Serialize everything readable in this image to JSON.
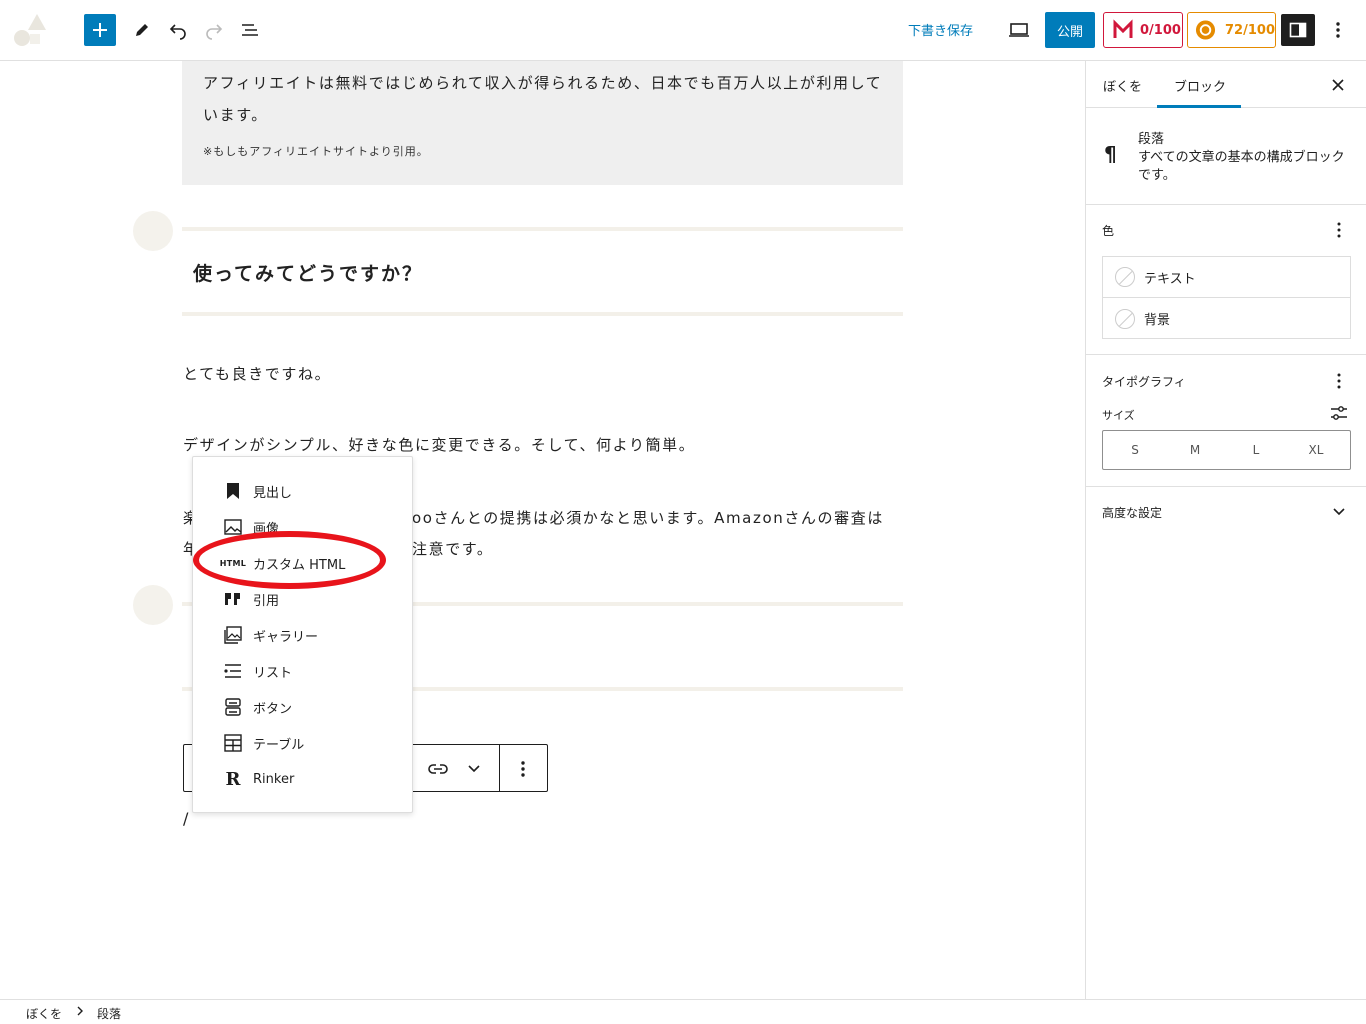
{
  "toolbar": {
    "save_draft": "下書き保存",
    "publish": "公開",
    "seo_score": "0/100",
    "readability_score": "72/100"
  },
  "content": {
    "quote_text": "アフィリエイトは無料ではじめられて収入が得られるため、日本でも百万人以上が利用しています。",
    "quote_cite": "※もしもアフィリエイトサイトより引用。",
    "heading": "使ってみてどうですか？",
    "para1": "とても良きですね。",
    "para2": "デザインがシンプル、好きな色に変更できる。そして、何より簡単。",
    "para3_left": "楽",
    "para3_right": "ooさんとの提携は必須かなと思います。Amazonさんの審査は",
    "para4_left": "年",
    "para4_right": "注意です。",
    "slash": "/"
  },
  "inserter": {
    "items": [
      {
        "label": "見出し",
        "icon": "bookmark-icon"
      },
      {
        "label": "画像",
        "icon": "image-icon"
      },
      {
        "label": "カスタム HTML",
        "icon": "html-icon"
      },
      {
        "label": "引用",
        "icon": "quote-icon"
      },
      {
        "label": "ギャラリー",
        "icon": "gallery-icon"
      },
      {
        "label": "リスト",
        "icon": "list-icon"
      },
      {
        "label": "ボタン",
        "icon": "buttons-icon"
      },
      {
        "label": "テーブル",
        "icon": "table-icon"
      },
      {
        "label": "Rinker",
        "icon": "rinker-icon"
      }
    ],
    "html_icon_text": "HTML",
    "rinker_icon_text": "R"
  },
  "sidebar": {
    "tab_post": "ぼくを",
    "tab_block": "ブロック",
    "block_name": "段落",
    "block_desc": "すべての文章の基本の構成ブロックです。",
    "color_title": "色",
    "color_text": "テキスト",
    "color_bg": "背景",
    "typography_title": "タイポグラフィ",
    "size_label": "サイズ",
    "sizes": [
      "S",
      "M",
      "L",
      "XL"
    ],
    "advanced_title": "高度な設定"
  },
  "breadcrumb": {
    "root": "ぼくを",
    "current": "段落"
  },
  "colors": {
    "accent": "#007cba",
    "highlight": "#e8141b",
    "seo": "#d1173b",
    "readability": "#e58b00"
  }
}
